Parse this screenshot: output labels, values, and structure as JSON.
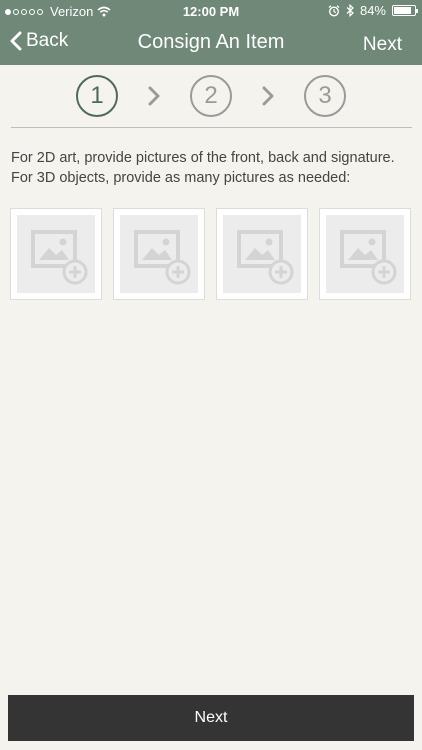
{
  "status": {
    "carrier": "Verizon",
    "time": "12:00 PM",
    "battery": "84%",
    "battery_level": 0.84
  },
  "nav": {
    "back_label": "Back",
    "title": "Consign An Item",
    "next_label": "Next"
  },
  "stepper": {
    "steps": [
      "1",
      "2",
      "3"
    ],
    "current_step": 1
  },
  "instructions": {
    "line1": "For 2D art, provide pictures of the front, back and signature.",
    "line2": "For 3D objects, provide as many pictures as needed:"
  },
  "photo_slots": [
    {
      "icon": "add-photo-icon"
    },
    {
      "icon": "add-photo-icon"
    },
    {
      "icon": "add-photo-icon"
    },
    {
      "icon": "add-photo-icon"
    }
  ],
  "footer": {
    "next_label": "Next"
  },
  "colors": {
    "header_bg": "#6f8878",
    "background": "#f5f3ee",
    "active_step": "#4f6a5c",
    "button_bg": "#343434"
  }
}
